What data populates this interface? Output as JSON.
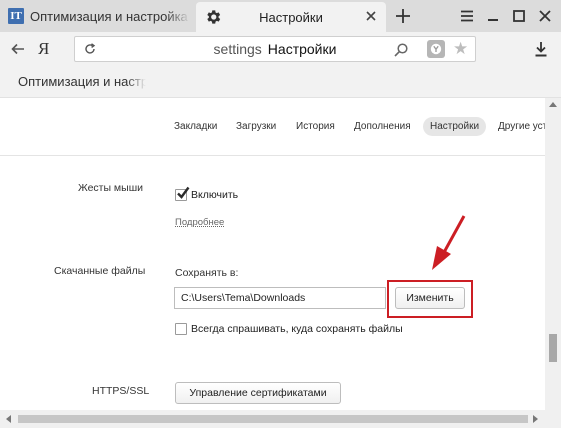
{
  "tabs": [
    {
      "label": "Оптимизация и настройка",
      "favicon_text": "IT",
      "active": false
    },
    {
      "label": "Настройки",
      "icon": "gear-icon",
      "active": true
    }
  ],
  "window_controls": [
    "menu-icon",
    "minimize-icon",
    "maximize-icon",
    "close-icon"
  ],
  "toolbar": {
    "logo": "Я",
    "address_host": "settings",
    "address_title": "Настройки"
  },
  "bookmarks_bar": {
    "items": [
      {
        "label": "Оптимизация и настройка"
      }
    ]
  },
  "settings_nav": {
    "items": [
      {
        "label": "Закладки"
      },
      {
        "label": "Загрузки"
      },
      {
        "label": "История"
      },
      {
        "label": "Дополнения"
      },
      {
        "label": "Настройки",
        "active": true
      },
      {
        "label": "Другие устройства"
      }
    ]
  },
  "sections": {
    "mouse_gestures": {
      "label": "Жесты мыши",
      "checkbox_label": "Включить",
      "checked": true,
      "more_link": "Подробнее"
    },
    "downloads": {
      "label": "Скачанные файлы",
      "save_to_label": "Сохранять в:",
      "path_value": "C:\\Users\\Tema\\Downloads",
      "change_button": "Изменить",
      "always_ask_label": "Всегда спрашивать, куда сохранять файлы",
      "always_ask_checked": false
    },
    "https": {
      "label": "HTTPS/SSL",
      "manage_certs_button": "Управление сертификатами"
    }
  },
  "annotation": {
    "color": "#cc1e24"
  },
  "colors": {
    "tabstrip": "#dcdcdc",
    "toolbar": "#f2f2f2",
    "accent_red": "#cc1e24"
  }
}
